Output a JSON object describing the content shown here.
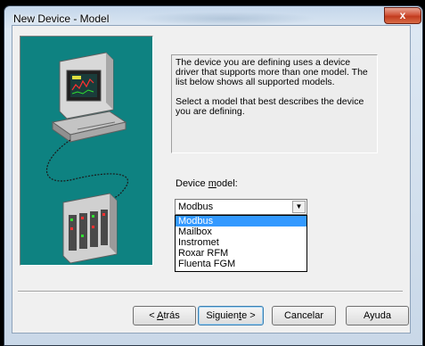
{
  "window": {
    "title": "New Device - Model",
    "close_glyph": "x"
  },
  "description": {
    "paragraph1": "The device you are defining uses a device driver that supports more than one model.  The list below shows all supported models.",
    "paragraph2": "Select  a model that best describes the device you are defining."
  },
  "device_model": {
    "label_before": "Device ",
    "label_mnemonic": "m",
    "label_after": "odel:",
    "selected_value": "Modbus",
    "options": [
      "Modbus",
      "Mailbox",
      "Instromet",
      "Roxar RFM",
      "Fluenta FGM"
    ],
    "highlighted_index": 0,
    "arrow_icon": "chevron-down-icon"
  },
  "buttons": {
    "back": {
      "prefix": "< ",
      "mnemonic": "A",
      "rest": "trás"
    },
    "next": {
      "prefix": "Siguien",
      "mnemonic": "t",
      "rest": "e >"
    },
    "cancel": "Cancelar",
    "help": "Ayuda"
  },
  "colors": {
    "illustration_bg": "#0e8281",
    "highlight": "#3399ff",
    "close_button": "#c9432a"
  }
}
